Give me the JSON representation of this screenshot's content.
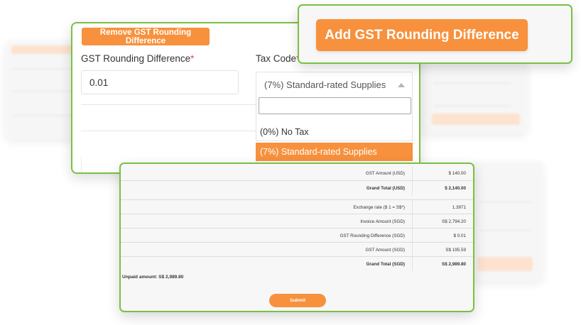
{
  "form_card": {
    "remove_button": "Remove GST Rounding Difference",
    "rounding_label": "GST Rounding Difference",
    "rounding_value": "0.01",
    "tax_code_label": "Tax Code",
    "required_mark": "*",
    "tax_code_selected": "(7%) Standard-rated Supplies",
    "search_value": "",
    "options": [
      "(0%) No Tax",
      "(7%) Standard-rated Supplies"
    ],
    "highlighted_option": "(7%) Standard-rated Supplies"
  },
  "add_card": {
    "add_button": "Add GST Rounding Difference"
  },
  "totals": {
    "rows": [
      {
        "label": "GST Amount (USD)",
        "value": "$ 140.00"
      },
      {
        "label": "Grand Total (USD)",
        "value": "$ 2,140.00"
      },
      {
        "label": "Exchange rate ($ 1 = S$*)",
        "value": "1.3971"
      },
      {
        "label": "Invoice Amount (SGD)",
        "value": "S$ 2,794.20"
      },
      {
        "label": "GST Rounding Difference (SGD)",
        "value": "$ 0.01"
      },
      {
        "label": "GST Amount (SGD)",
        "value": "S$ 195.59"
      },
      {
        "label": "Grand Total (SGD)",
        "value": "S$ 2,989.80"
      }
    ],
    "unpaid": "Unpaid amount: S$ 2,989.80",
    "submit": "Submit"
  },
  "colors": {
    "accent": "#f7913d",
    "highlight_border": "#7ac043",
    "required": "#e34646"
  }
}
